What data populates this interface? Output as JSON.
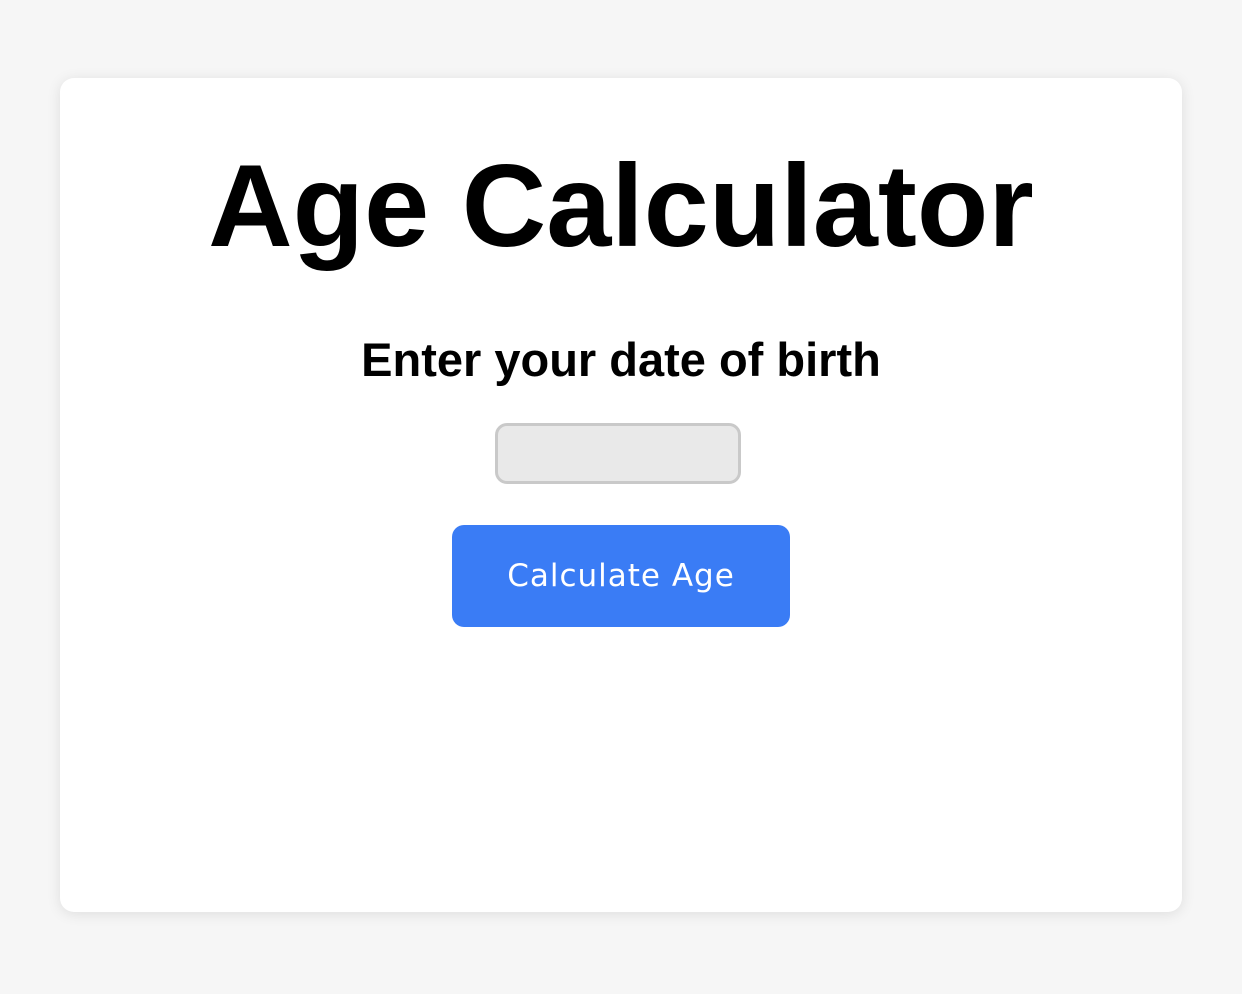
{
  "app": {
    "title": "Age Calculator",
    "prompt": "Enter your date of birth"
  },
  "form": {
    "dob_value": "",
    "calculate_label": "Calculate Age"
  },
  "result": {
    "text": ""
  },
  "colors": {
    "page_background": "#f6f6f6",
    "card_background": "#ffffff",
    "button_accent": "#3a7cf5",
    "input_background": "#e9e9e9",
    "input_border": "#c9c9c9"
  }
}
